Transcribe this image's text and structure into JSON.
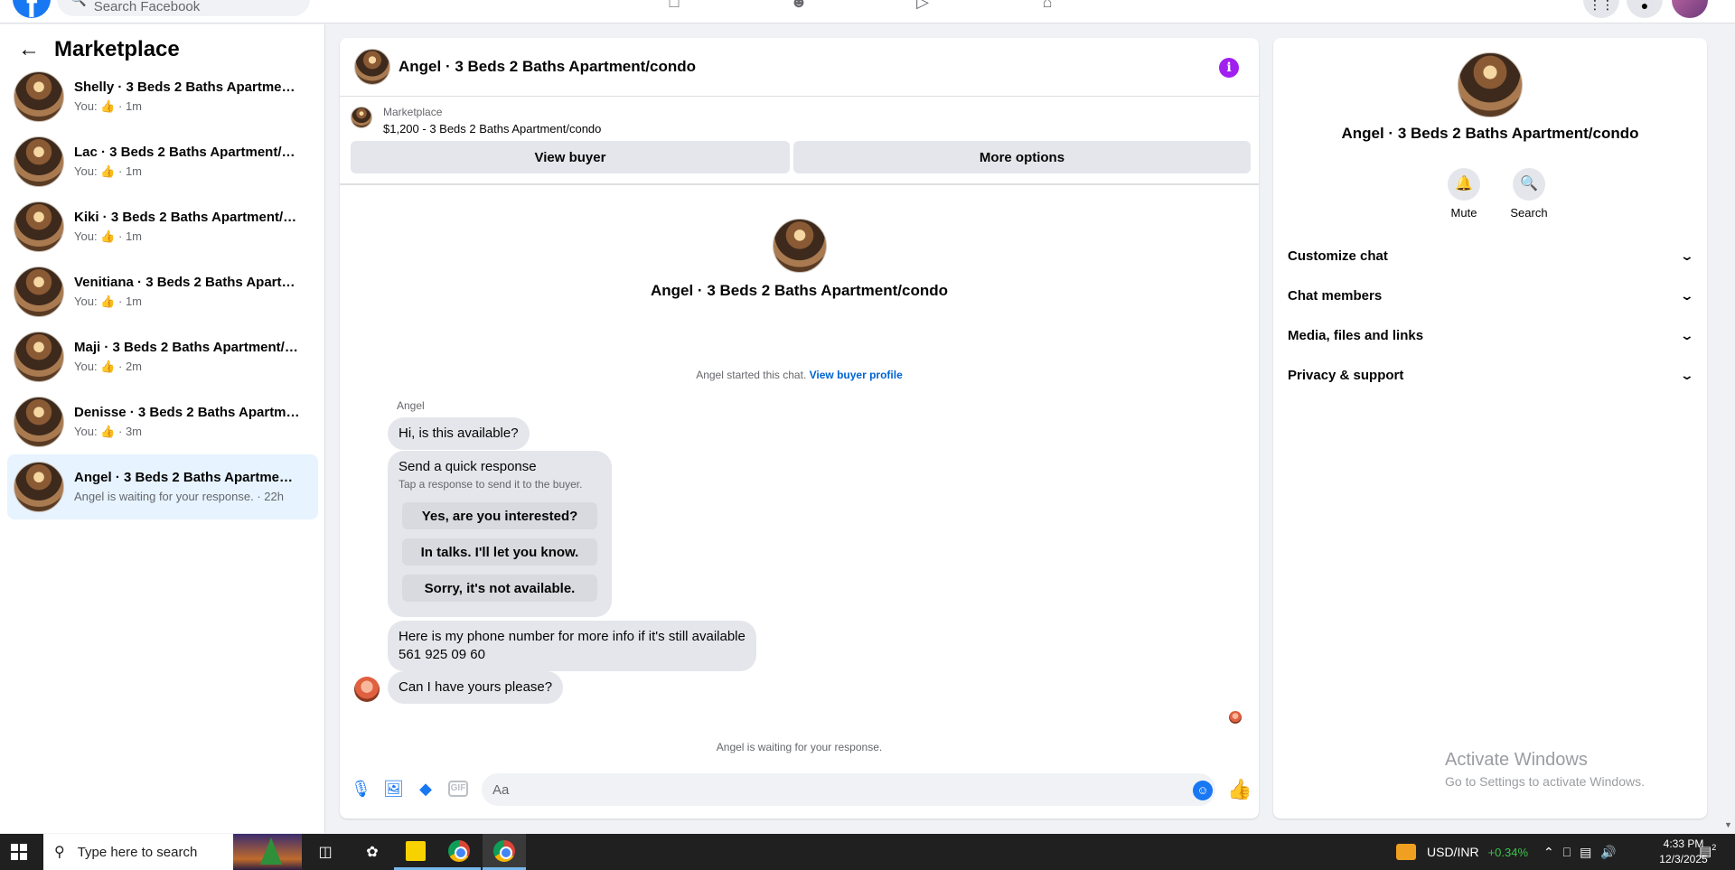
{
  "topbar": {
    "logo": "f",
    "search_placeholder": "Search Facebook",
    "nav_icons": [
      "home-icon",
      "friends-icon",
      "video-icon",
      "marketplace-icon"
    ],
    "right_icons": [
      "menu-icon",
      "notifications-icon",
      "profile-avatar"
    ]
  },
  "sidebar": {
    "title": "Marketplace",
    "conversations": [
      {
        "title": "Shelly · 3 Beds 2 Baths Apartment/...",
        "sub_prefix": "You:",
        "sub_time": "· 1m"
      },
      {
        "title": "Lac · 3 Beds 2 Baths Apartment/co...",
        "sub_prefix": "You:",
        "sub_time": "· 1m"
      },
      {
        "title": "Kiki · 3 Beds 2 Baths Apartment/co...",
        "sub_prefix": "You:",
        "sub_time": "· 1m"
      },
      {
        "title": "Venitiana · 3 Beds 2 Baths Apartm...",
        "sub_prefix": "You:",
        "sub_time": "· 1m"
      },
      {
        "title": "Maji · 3 Beds 2 Baths Apartment/c...",
        "sub_prefix": "You:",
        "sub_time": "· 2m"
      },
      {
        "title": "Denisse · 3 Beds 2 Baths Apartmen...",
        "sub_prefix": "You:",
        "sub_time": "· 3m"
      },
      {
        "title": "Angel · 3 Beds 2 Baths Apartment/...",
        "sub_text": "Angel is waiting for your response. · 22h"
      }
    ]
  },
  "chat": {
    "header_name": "Angel · 3 Beds 2 Baths Apartment/condo",
    "listing_source": "Marketplace",
    "listing_price_title": "$1,200 - 3 Beds 2 Baths Apartment/condo",
    "view_buyer_label": "View buyer",
    "more_options_label": "More options",
    "intro_name": "Angel · 3 Beds 2 Baths Apartment/condo",
    "started_text": "Angel started this chat.",
    "view_profile_link": "View buyer profile",
    "sender_name": "Angel",
    "messages": {
      "m1": "Hi, is this available?",
      "m2_line1": "Here is my phone number for more info if it's still available",
      "m2_line2": "561 925 09 60",
      "m3": "Can I have yours please?"
    },
    "quick_response": {
      "title": "Send a quick response",
      "subtitle": "Tap a response to send it to the buyer.",
      "options": [
        "Yes, are you interested?",
        "In talks. I'll let you know.",
        "Sorry, it's not available."
      ]
    },
    "waiting_text": "Angel is waiting for your response.",
    "composer_placeholder": "Aa",
    "gif_label": "GIF"
  },
  "info_panel": {
    "name": "Angel · 3 Beds 2 Baths Apartment/condo",
    "mute_label": "Mute",
    "search_label": "Search",
    "sections": [
      "Customize chat",
      "Chat members",
      "Media, files and links",
      "Privacy & support"
    ],
    "activate_title": "Activate Windows",
    "activate_sub": "Go to Settings to activate Windows."
  },
  "taskbar": {
    "search_text": "Type here to search",
    "ticker_name": "USD/INR",
    "ticker_change": "+0.34%",
    "time": "4:33 PM",
    "date": "12/3/2025",
    "notif_count": "2"
  },
  "colors": {
    "accent": "#1877f2",
    "active_row": "#e7f3ff",
    "info_icon": "#a020f0",
    "ticker_positive": "#3cc24a"
  }
}
